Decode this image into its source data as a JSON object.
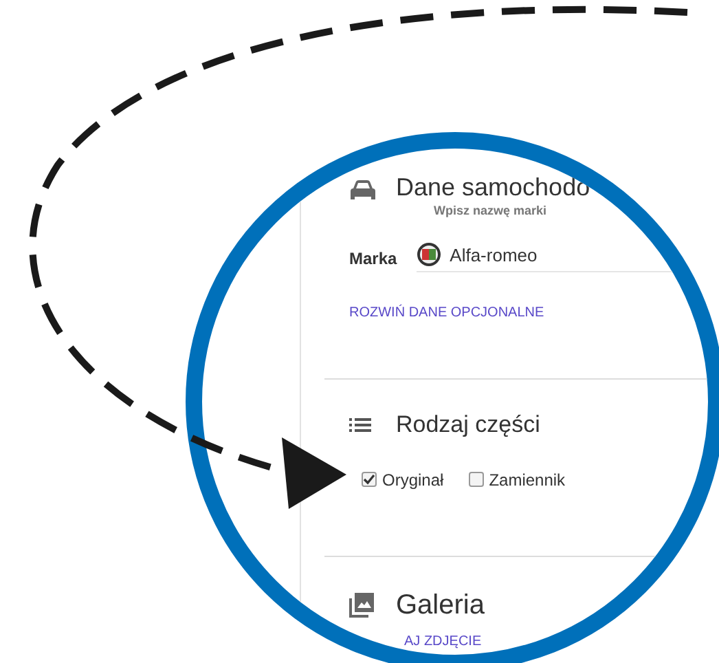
{
  "car_section": {
    "title": "Dane samochodo",
    "hint": "Wpisz nazwę marki",
    "field_label": "Marka",
    "field_value": "Alfa-romeo",
    "link": "ROZWIŃ DANE OPCJONALNE"
  },
  "part_type_section": {
    "title": "Rodzaj części",
    "options": [
      {
        "label": "Oryginał",
        "checked": true
      },
      {
        "label": "Zamiennik",
        "checked": false
      }
    ]
  },
  "gallery_section": {
    "title": "Galeria",
    "link": "AJ ZDJĘCIE"
  }
}
